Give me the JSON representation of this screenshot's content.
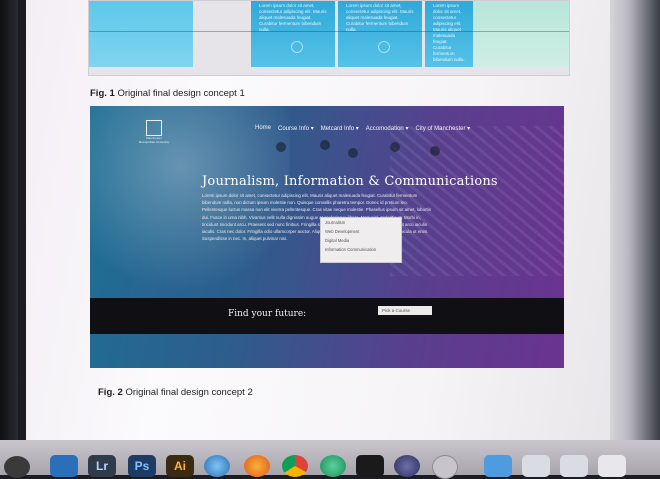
{
  "figure1": {
    "caption_bold": "Fig. 1",
    "caption_text": " Original final design concept 1",
    "columns": [
      {
        "text": "Lorem ipsum dolor sit amet, consectetur adipiscing elit. Mauris aliquet malesuada feugiat. Curabitur fermentum bibendum nulla."
      },
      {
        "text": "Lorem ipsum dolor sit amet, consectetur adipiscing elit. Mauris aliquet malesuada feugiat. Curabitur fermentum bibendum nulla."
      },
      {
        "text": "Lorem ipsum dolor sit amet, consectetur adipiscing elit. Mauris aliquet malesuada feugiat. Curabitur fermentum bibendum nulla."
      }
    ]
  },
  "figure2": {
    "caption_bold": "Fig. 2",
    "caption_text": " Original final design concept 2",
    "logo_text": "Manchester Metropolitan University",
    "nav": [
      "Home",
      "Course Info ▾",
      "Metcard Info ▾",
      "Accomodation ▾",
      "City of Manchester ▾"
    ],
    "hero_title": "Journalism, Information & Communications",
    "hero_body": "Lorem ipsum dolor sit amet, consectetur adipiscing elit. Mauris aliquet malesuada feugiat. Curabitur fermentum bibendum nulla, non dictum ipsum molestie non. Quisque convallis pharetra tempor. Donec id pretium leo. Pellentesque luctus massa non elit viverra pellentesque. Cras vitae neque molestie. Phasellus ipsum sit amet, lobortis dui. Fusce in urna nibh. Vivamus velit nulla dignissim augue at scelerisque libero. Nam nisl, molestie at. Morbi in, tincidunt tincidunt arcu. Praesent sed nunc finibus. Fringilla sed quis, mollis erat. Donec blandit metus ut arcu iaculis iaculis. Cras nec dolor. Fringilla odio ullamcorper auctor. Aliquam eget pretium elit. Morbi urna nibh, vehicula ut enim. Suspendisse in nec. In, aliquet pulvinar nisi.",
    "footer_label": "Find your future:",
    "select_value": "Pick a Course",
    "dropdown_options": [
      "Journalism",
      "Web Development",
      "Digital Media",
      "Information Communication"
    ]
  },
  "dock": {
    "apps": [
      {
        "name": "Lr",
        "color": "#2f3a4a"
      },
      {
        "name": "Ps",
        "color": "#1d3b63"
      },
      {
        "name": "Ai",
        "color": "#3a2a12"
      }
    ]
  },
  "colors": {
    "fig1_blue": "#2fa9d9",
    "fig2_gradient_start": "#1f6f95",
    "fig2_gradient_end": "#6a3390"
  }
}
